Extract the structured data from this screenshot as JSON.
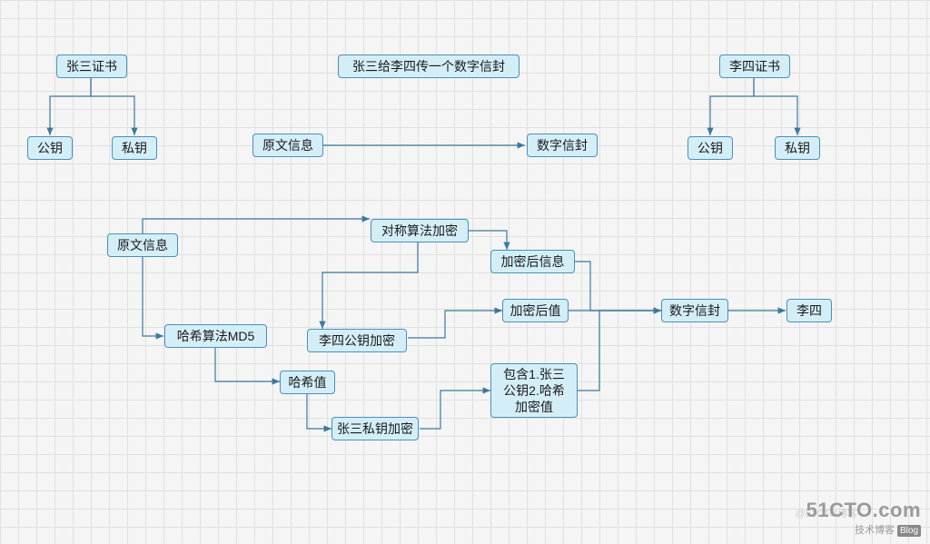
{
  "chart_data": {
    "type": "diagram",
    "title": "张三给李四传一个数字信封",
    "nodes": [
      {
        "id": "zs_cert",
        "label": "张三证书"
      },
      {
        "id": "zs_pub",
        "label": "公钥"
      },
      {
        "id": "zs_priv",
        "label": "私钥"
      },
      {
        "id": "ls_cert",
        "label": "李四证书"
      },
      {
        "id": "ls_pub",
        "label": "公钥"
      },
      {
        "id": "ls_priv",
        "label": "私钥"
      },
      {
        "id": "plain_top",
        "label": "原文信息"
      },
      {
        "id": "env_top",
        "label": "数字信封"
      },
      {
        "id": "plain",
        "label": "原文信息"
      },
      {
        "id": "sym_enc",
        "label": "对称算法加密"
      },
      {
        "id": "enc_info",
        "label": "加密后信息"
      },
      {
        "id": "md5",
        "label": "哈希算法MD5"
      },
      {
        "id": "ls_pub_enc",
        "label": "李四公钥加密"
      },
      {
        "id": "enc_val",
        "label": "加密后值"
      },
      {
        "id": "hash",
        "label": "哈希值"
      },
      {
        "id": "zs_priv_enc",
        "label": "张三私钥加密"
      },
      {
        "id": "bundle",
        "label": "包含1.张三公钥2.哈希加密值"
      },
      {
        "id": "envelope",
        "label": "数字信封"
      },
      {
        "id": "lisi",
        "label": "李四"
      }
    ],
    "edges": [
      [
        "zs_cert",
        "zs_pub"
      ],
      [
        "zs_cert",
        "zs_priv"
      ],
      [
        "ls_cert",
        "ls_pub"
      ],
      [
        "ls_cert",
        "ls_priv"
      ],
      [
        "plain_top",
        "env_top"
      ],
      [
        "plain",
        "sym_enc"
      ],
      [
        "sym_enc",
        "enc_info"
      ],
      [
        "sym_enc",
        "ls_pub_enc"
      ],
      [
        "ls_pub_enc",
        "enc_val"
      ],
      [
        "plain",
        "md5"
      ],
      [
        "md5",
        "hash"
      ],
      [
        "hash",
        "zs_priv_enc"
      ],
      [
        "zs_priv_enc",
        "bundle"
      ],
      [
        "enc_info",
        "envelope"
      ],
      [
        "enc_val",
        "envelope"
      ],
      [
        "bundle",
        "envelope"
      ],
      [
        "envelope",
        "lisi"
      ]
    ]
  },
  "nodes": {
    "zs_cert": "张三证书",
    "zs_pub": "公钥",
    "zs_priv": "私钥",
    "title": "张三给李四传一个数字信封",
    "ls_cert": "李四证书",
    "ls_pub": "公钥",
    "ls_priv": "私钥",
    "plain_top": "原文信息",
    "env_top": "数字信封",
    "plain": "原文信息",
    "sym_enc": "对称算法加密",
    "enc_info": "加密后信息",
    "md5": "哈希算法MD5",
    "ls_pub_enc": "李四公钥加密",
    "enc_val": "加密后值",
    "hash": "哈希值",
    "zs_priv_enc": "张三私钥加密",
    "bundle": "包含1.张三\n公钥2.哈希\n加密值",
    "envelope": "数字信封",
    "lisi": "李四"
  },
  "watermark": {
    "logo": "51CTO.com",
    "sub": "技术博客",
    "blog": "Blog",
    "faint": "@51CTO博客"
  }
}
